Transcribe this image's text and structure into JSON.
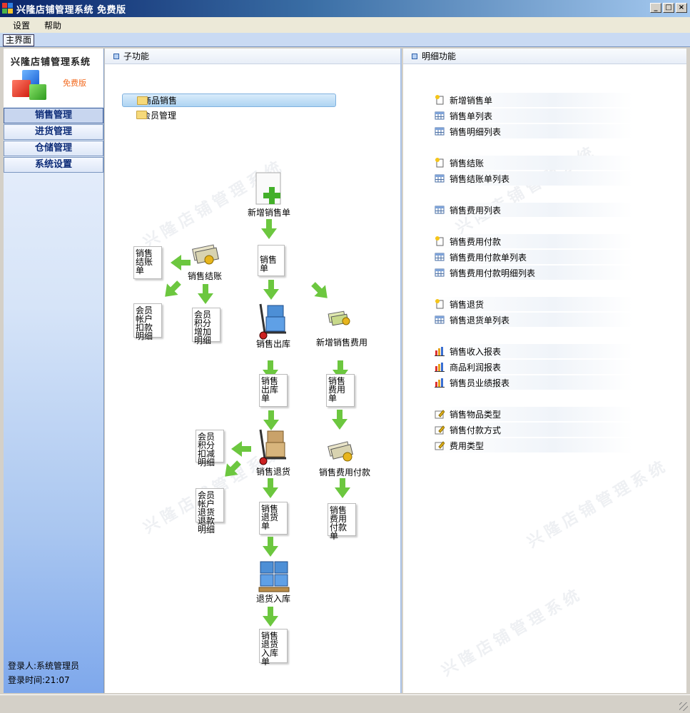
{
  "window": {
    "title": "兴隆店铺管理系统 免费版"
  },
  "menu": {
    "items": [
      "设置",
      "帮助"
    ]
  },
  "tabs": {
    "main": "主界面"
  },
  "nav": {
    "app_name": "兴隆店铺管理系统",
    "edition": "免费版",
    "buttons": [
      "销售管理",
      "进货管理",
      "仓储管理",
      "系统设置"
    ],
    "active": "销售管理",
    "login_user_label": "登录人:",
    "login_user": "系统管理员",
    "login_time_label": "登录时间:",
    "login_time": "21:07"
  },
  "sub_panel": {
    "title": "子功能",
    "tree": [
      "商品销售",
      "会员管理"
    ],
    "selected": "商品销售"
  },
  "flow": {
    "new_sale": "新增销售单",
    "sale_doc": "销售单",
    "settle": "销售结账",
    "settle_doc": "销售结账单",
    "member_acct_deduct": "会员帐户扣款明细",
    "member_points_add": "会员积分增加明细",
    "outbound": "销售出库",
    "outbound_doc": "销售出库单",
    "new_expense": "新增销售费用",
    "expense_doc": "销售费用单",
    "return": "销售退货",
    "points_deduct": "会员积分扣减明细",
    "acct_refund": "会员帐户退货退款明细",
    "return_doc": "销售退货单",
    "expense_pay": "销售费用付款",
    "expense_pay_doc": "销售费用付款单",
    "return_in": "退货入库",
    "return_in_doc": "销售退货入库单"
  },
  "detail_panel": {
    "title": "明细功能",
    "items": [
      {
        "label": "新增销售单",
        "icon": "new-doc-icon"
      },
      {
        "label": "销售单列表",
        "icon": "table-icon"
      },
      {
        "label": "销售明细列表",
        "icon": "table-icon"
      },
      {
        "label": "销售结账",
        "icon": "new-doc-icon"
      },
      {
        "label": "销售结账单列表",
        "icon": "table-icon"
      },
      {
        "label": "销售费用列表",
        "icon": "table-icon"
      },
      {
        "label": "销售费用付款",
        "icon": "new-doc-icon"
      },
      {
        "label": "销售费用付款单列表",
        "icon": "table-icon"
      },
      {
        "label": "销售费用付款明细列表",
        "icon": "table-icon"
      },
      {
        "label": "销售退货",
        "icon": "new-doc-icon"
      },
      {
        "label": "销售退货单列表",
        "icon": "table-icon"
      },
      {
        "label": "销售收入报表",
        "icon": "bar-chart-icon"
      },
      {
        "label": "商品利润报表",
        "icon": "bar-chart-icon"
      },
      {
        "label": "销售员业绩报表",
        "icon": "bar-chart-icon"
      },
      {
        "label": "销售物品类型",
        "icon": "edit-icon"
      },
      {
        "label": "销售付款方式",
        "icon": "edit-icon"
      },
      {
        "label": "费用类型",
        "icon": "edit-icon"
      }
    ]
  },
  "watermark": {
    "text": "兴隆店铺管理系统",
    "small": "免费版"
  },
  "colors": {
    "title_bar": "#0a246a",
    "nav_text": "#0d2c78",
    "arrow": "#6cc73f",
    "edition": "#f26b21"
  }
}
